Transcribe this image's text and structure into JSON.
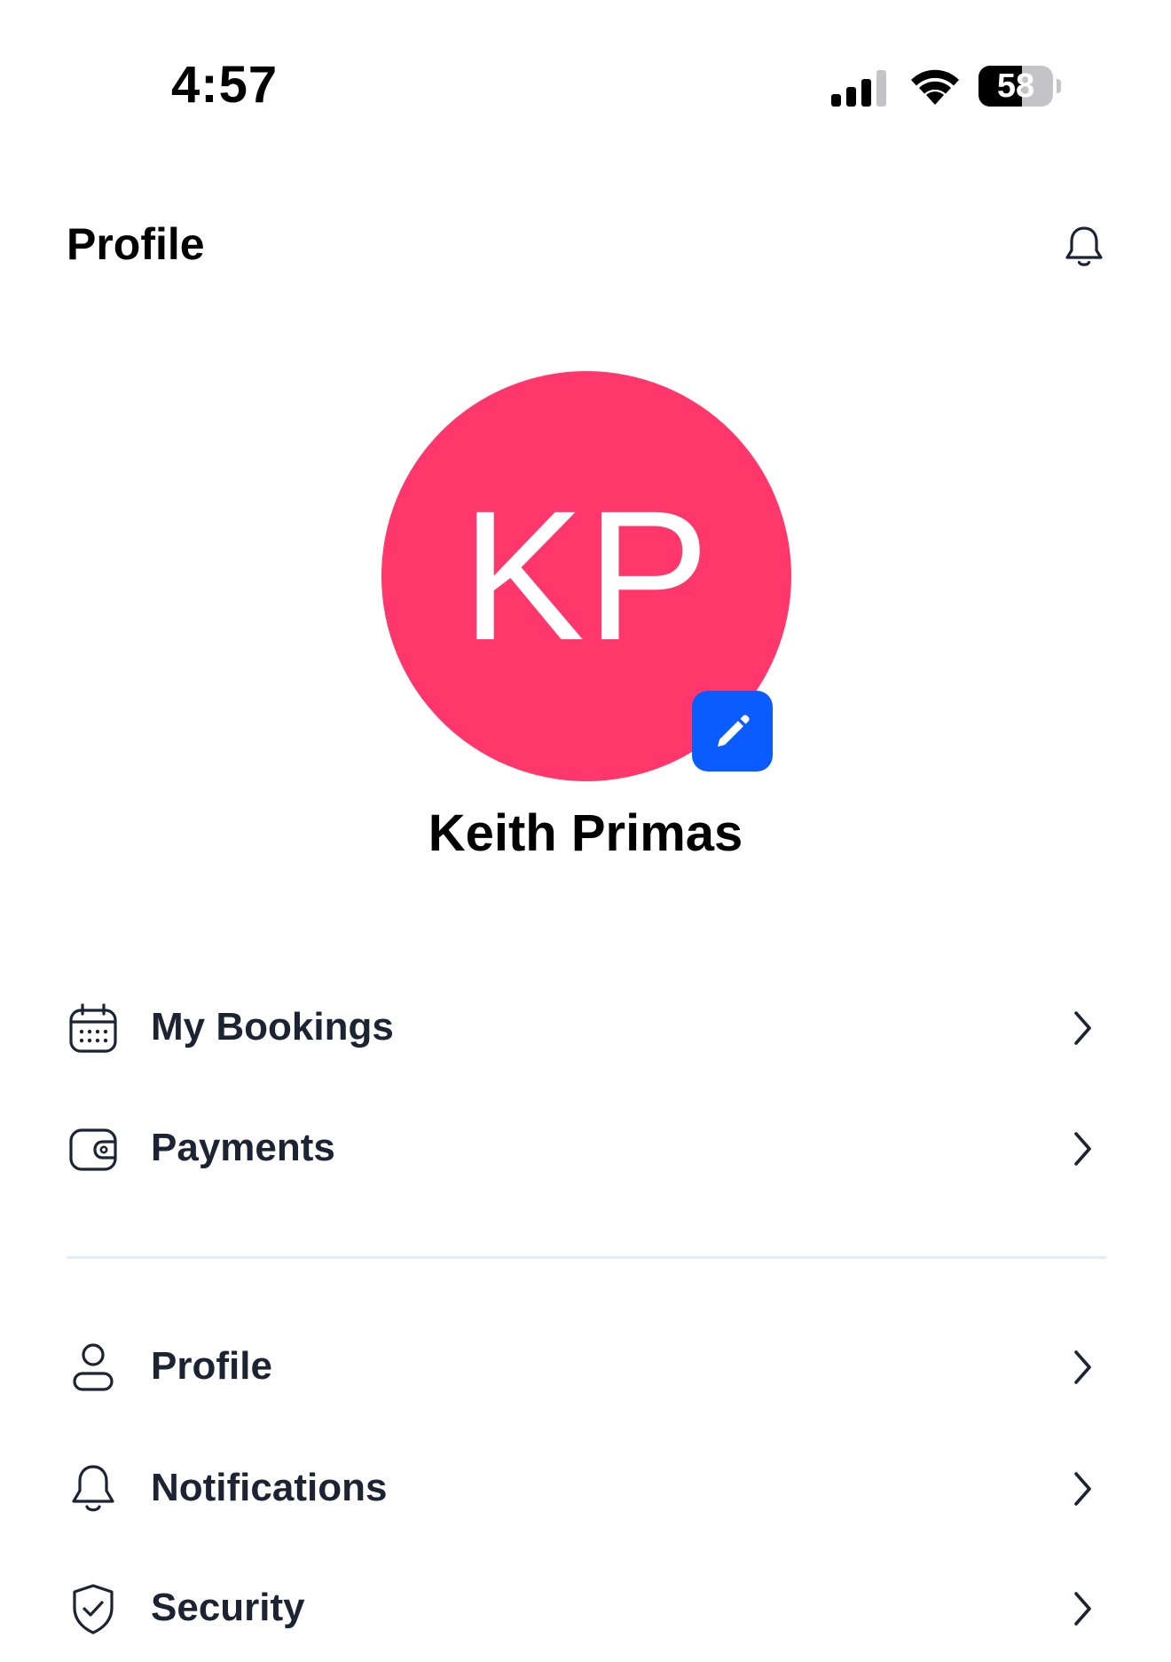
{
  "status_bar": {
    "time": "4:57",
    "battery_level": "58",
    "battery_fraction": 0.58,
    "icons": [
      "signal-icon",
      "wifi-icon",
      "battery-icon"
    ]
  },
  "header": {
    "title": "Profile",
    "icon": "bell-icon"
  },
  "profile": {
    "initials": "KP",
    "name": "Keith Primas",
    "avatar_color": "#ff376b",
    "edit_icon": "pencil-icon",
    "edit_button_color": "#0a5cff"
  },
  "menu": {
    "section_1": [
      {
        "label": "My Bookings",
        "icon": "calendar-icon"
      },
      {
        "label": "Payments",
        "icon": "wallet-icon"
      }
    ],
    "section_2": [
      {
        "label": "Profile",
        "icon": "user-icon"
      },
      {
        "label": "Notifications",
        "icon": "bell-icon"
      },
      {
        "label": "Security",
        "icon": "shield-icon"
      }
    ]
  },
  "colors": {
    "text_primary": "#000000",
    "menu_text": "#1c2333",
    "divider": "#e3ebf4",
    "chevron": "#1c2333"
  }
}
